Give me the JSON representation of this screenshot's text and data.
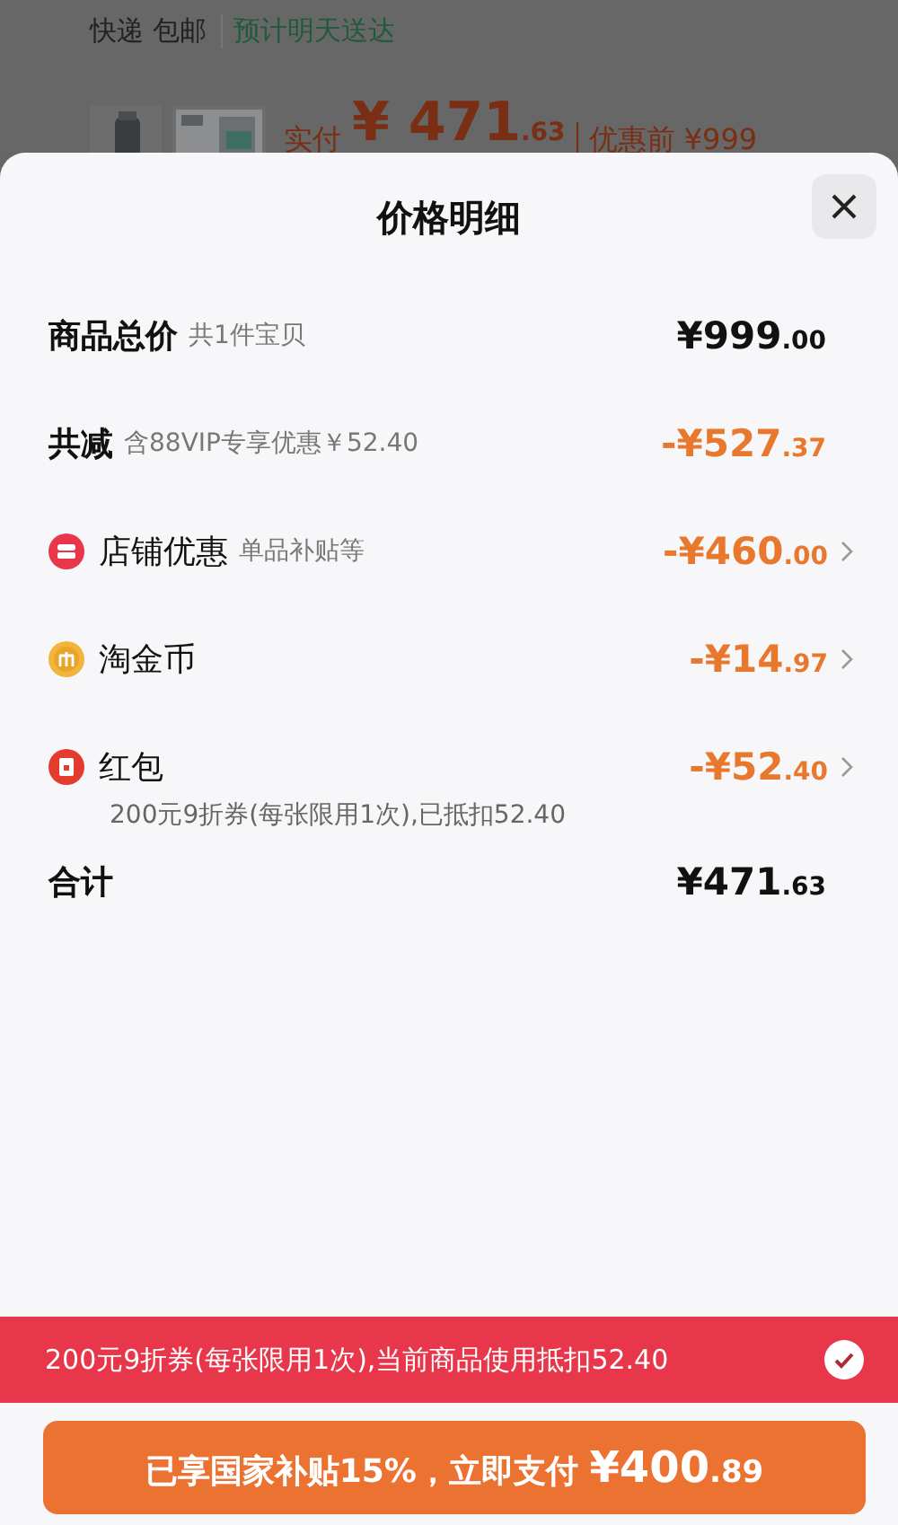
{
  "background_page": {
    "shipping": "快递 包邮",
    "delivery": "预计明天送达",
    "paid_label": "实付",
    "paid_amount": {
      "main": "¥ 471",
      "cents": ".63"
    },
    "original_label": "优惠前 ¥999"
  },
  "sheet": {
    "title": "价格明细",
    "goods_total": {
      "label": "商品总价",
      "note": "共1件宝贝",
      "amount": {
        "main": "¥999",
        "cents": ".00"
      }
    },
    "reduction": {
      "label": "共减",
      "note": "含88VIP专享优惠￥52.40",
      "amount": {
        "main": "-¥527",
        "cents": ".37"
      }
    },
    "discounts": [
      {
        "kind": "store",
        "label": "店铺优惠",
        "note": "单品补贴等",
        "amount": {
          "main": "-¥460",
          "cents": ".00"
        }
      },
      {
        "kind": "coin",
        "label": "淘金币",
        "amount": {
          "main": "-¥14",
          "cents": ".97"
        }
      },
      {
        "kind": "redpacket",
        "label": "红包",
        "amount": {
          "main": "-¥52",
          "cents": ".40"
        },
        "detail": "200元9折券(每张限用1次),已抵扣52.40"
      }
    ],
    "total": {
      "label": "合计",
      "amount": {
        "main": "¥471",
        "cents": ".63"
      }
    },
    "coupon_bar": {
      "text": "200元9折券(每张限用1次),当前商品使用抵扣52.40",
      "checked": true
    },
    "pay_button": {
      "text": "已享国家补贴15%，立即支付",
      "amount": {
        "main": "¥400",
        "cents": ".89"
      }
    }
  }
}
